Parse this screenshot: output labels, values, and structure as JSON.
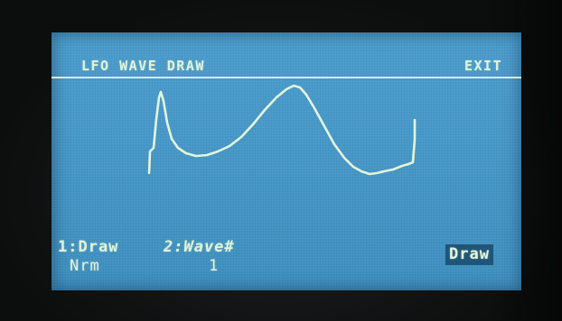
{
  "screen": {
    "title": "LFO WAVE DRAW",
    "exit_label": "EXIT"
  },
  "params": {
    "p1": {
      "label": "1:Draw",
      "value": "Nrm"
    },
    "p2": {
      "label": "2:Wave#",
      "value": "1"
    }
  },
  "action": {
    "label": "Draw"
  },
  "colors": {
    "lcd_background": "#4798c8",
    "lcd_text": "#e2f3d8",
    "button_background": "#1f5578"
  }
}
